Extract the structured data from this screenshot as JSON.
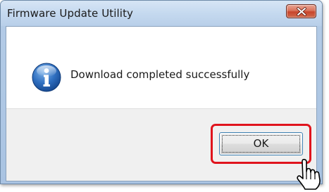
{
  "window": {
    "title": "Firmware Update Utility"
  },
  "message": {
    "text": "Download completed successfully",
    "icon": "info-icon"
  },
  "buttons": {
    "ok_label": "OK",
    "close_icon": "close-icon"
  },
  "colors": {
    "highlight": "#e0141d",
    "close_button": "#c7452b",
    "info_icon": "#1f5fae"
  },
  "cursor": "hand-pointer-cursor"
}
